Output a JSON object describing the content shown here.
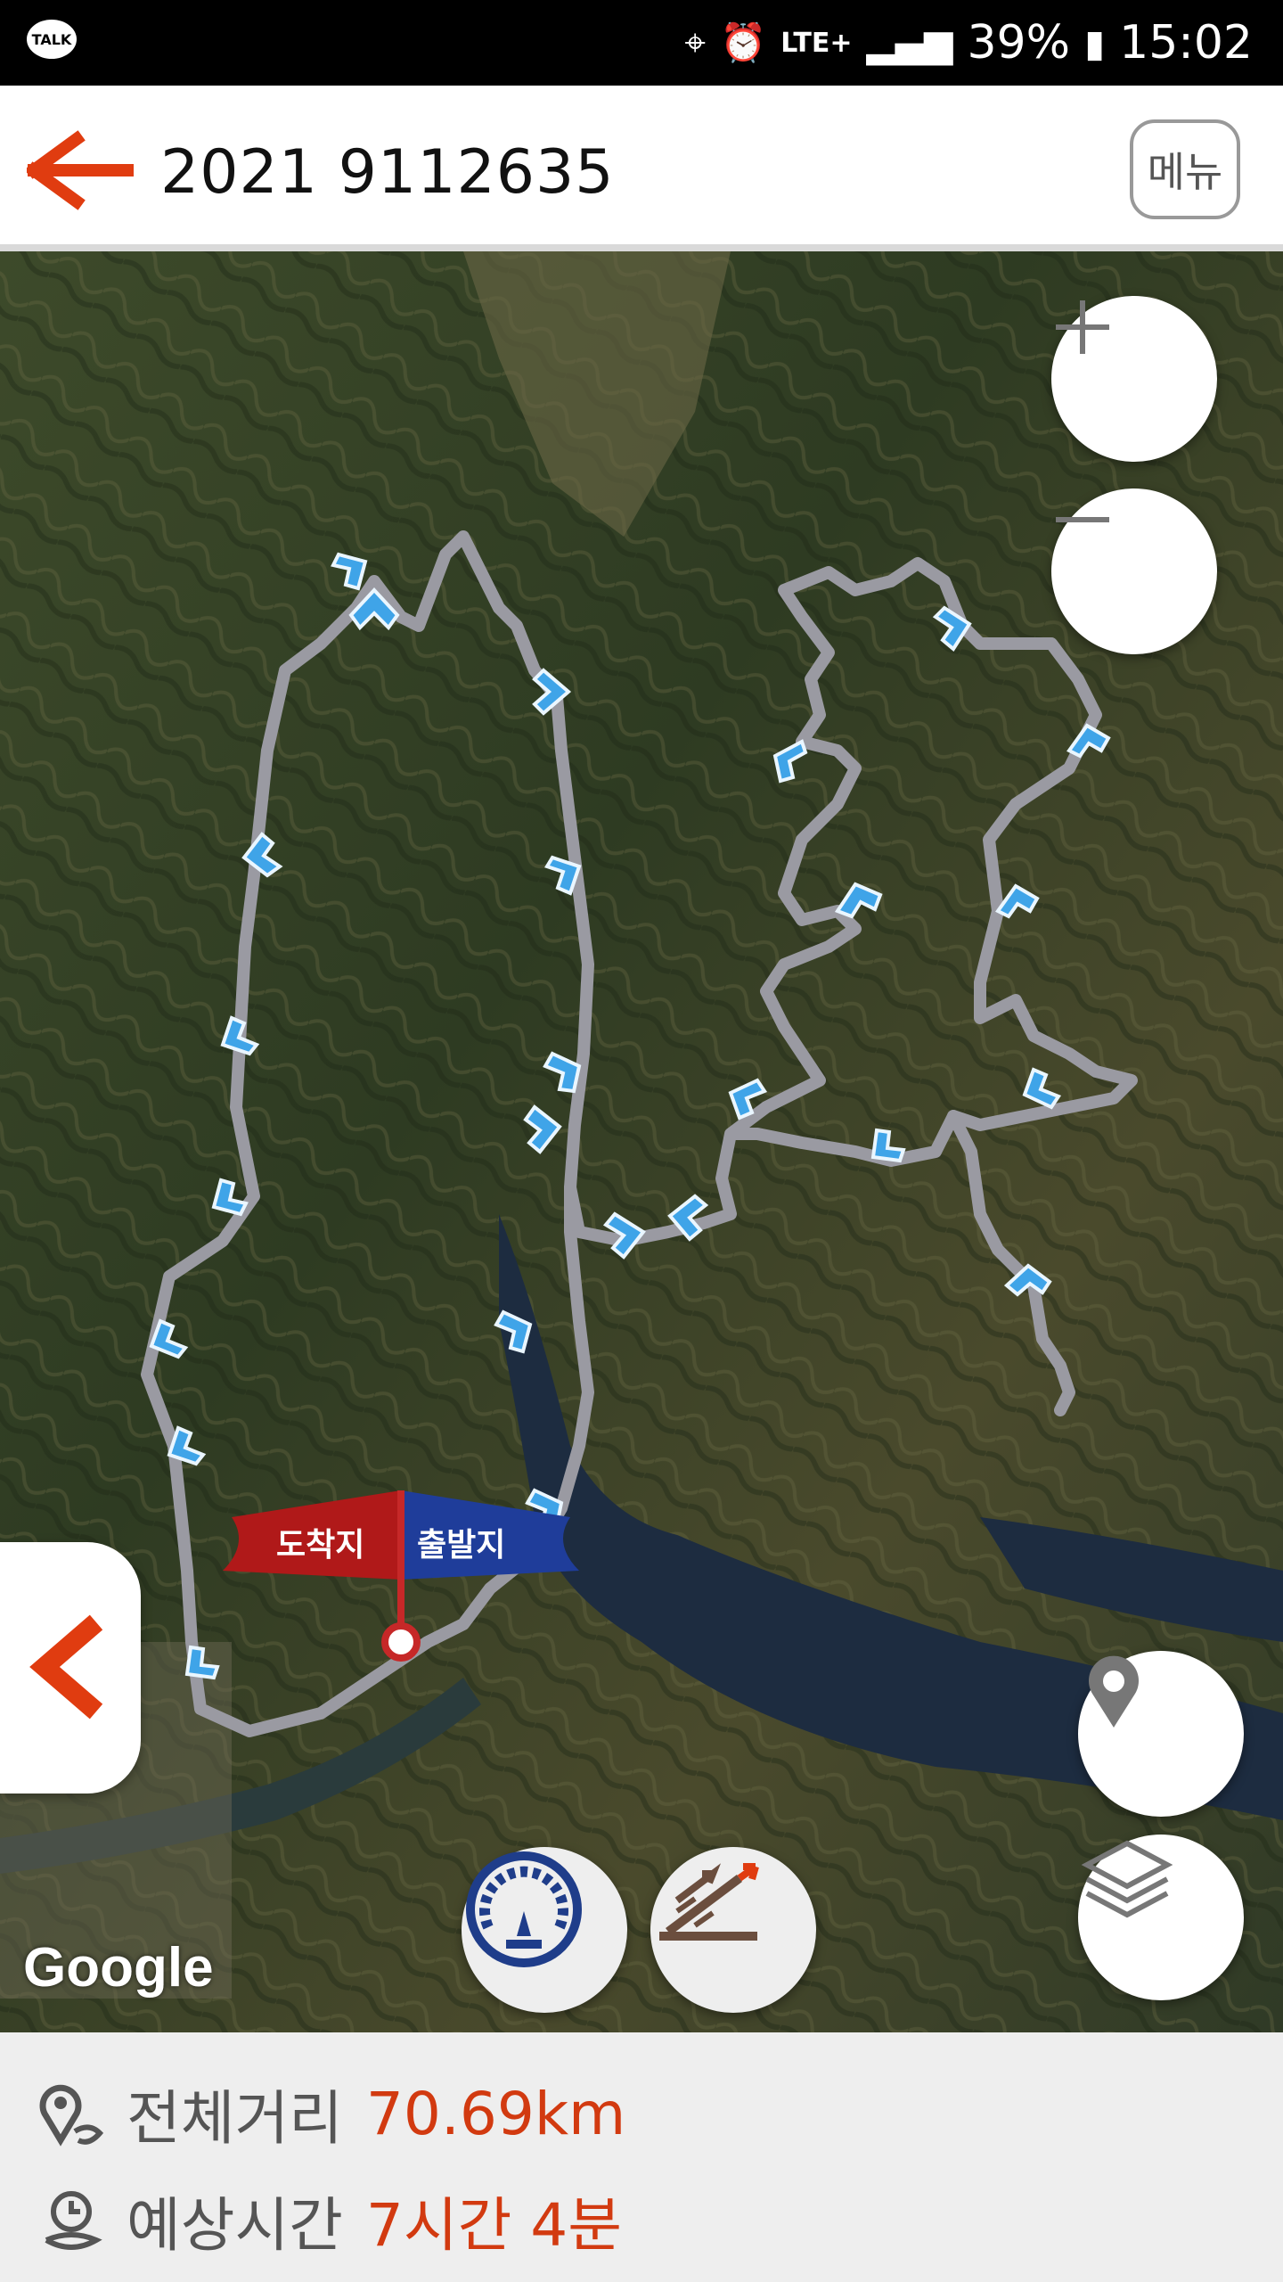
{
  "status_bar": {
    "left_icon": "kakaotalk-icon",
    "left_icon_text": "TALK",
    "network": "LTE+",
    "battery": "39%",
    "time": "15:02"
  },
  "app_bar": {
    "title": "2021 9112635",
    "menu_label": "메뉴",
    "back_color": "#e03c10"
  },
  "map": {
    "google_label": "Google",
    "start_label": "출발지",
    "end_label": "도착지",
    "route_color": "#9a9aa2",
    "start_flag_color": "#1f3d9a",
    "end_flag_color": "#b01919"
  },
  "summary": {
    "distance_label": "전체거리",
    "distance_value": "70.69km",
    "time_label": "예상시간",
    "time_value": "7시간 4분",
    "value_color": "#d23a10"
  }
}
